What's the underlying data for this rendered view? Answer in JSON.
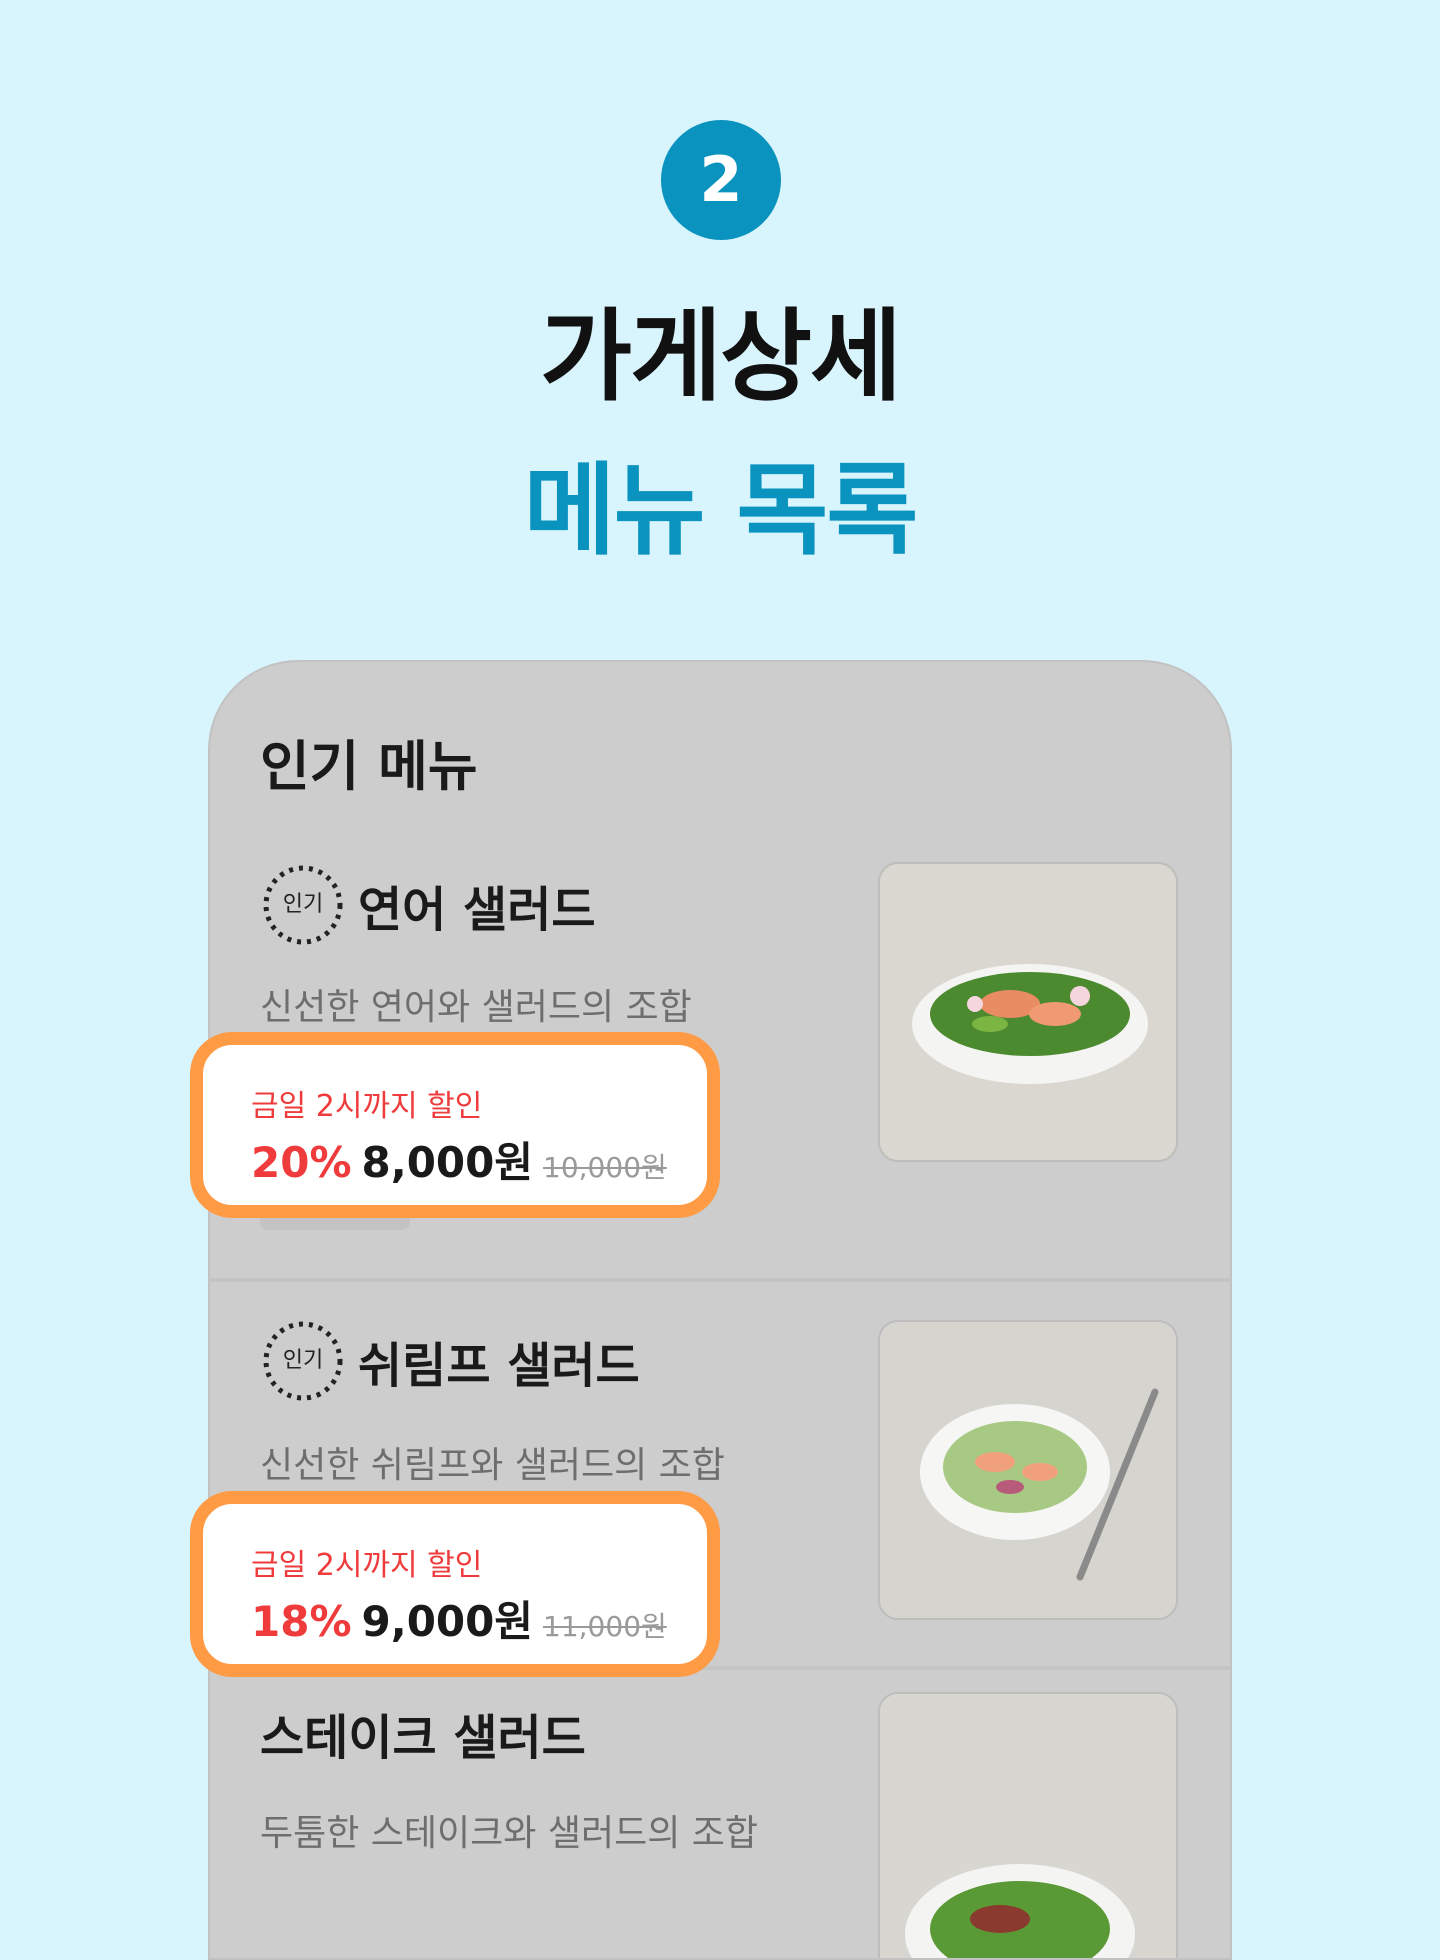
{
  "step_number": "2",
  "title_line1": "가게상세",
  "title_line2": "메뉴 목록",
  "colors": {
    "accent": "#0a93be",
    "background": "#d8f4fc",
    "highlight_border": "#ff9a45",
    "discount_red": "#ef3b3b"
  },
  "menu": {
    "section_title": "인기 메뉴",
    "items": [
      {
        "badge": "인기",
        "name": "연어 샐러드",
        "description": "신선한 연어와 샐러드의 조합",
        "icon": "salmon-salad-photo",
        "deal": {
          "when": "금일 2시까지 할인",
          "percent": "20%",
          "price": "8,000원",
          "original_price": "10,000원"
        }
      },
      {
        "badge": "인기",
        "name": "쉬림프 샐러드",
        "description": "신선한 쉬림프와 샐러드의 조합",
        "icon": "shrimp-salad-photo",
        "deal": {
          "when": "금일 2시까지 할인",
          "percent": "18%",
          "price": "9,000원",
          "original_price": "11,000원"
        }
      },
      {
        "name": "스테이크 샐러드",
        "description": "두툼한 스테이크와 샐러드의 조합",
        "icon": "steak-salad-photo"
      }
    ]
  }
}
